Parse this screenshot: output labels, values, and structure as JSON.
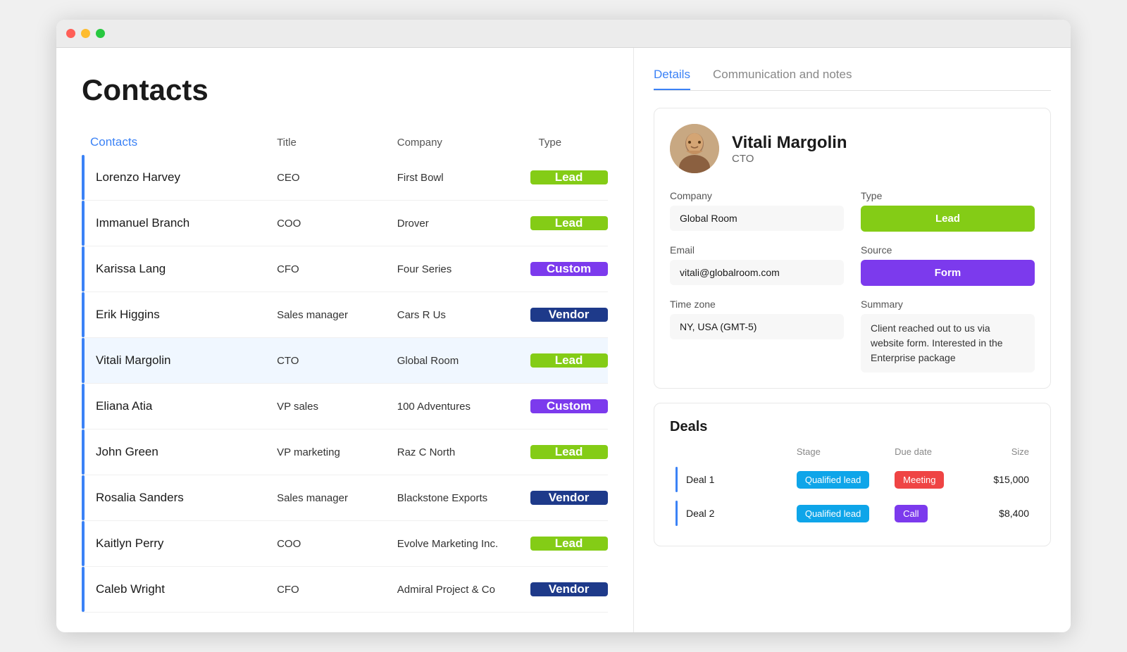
{
  "window": {
    "title": "Contacts"
  },
  "page": {
    "title": "Contacts"
  },
  "left_panel": {
    "columns": {
      "contacts": "Contacts",
      "title": "Title",
      "company": "Company",
      "type": "Type"
    },
    "rows": [
      {
        "name": "Lorenzo Harvey",
        "title": "CEO",
        "company": "First Bowl",
        "type": "Lead",
        "type_class": "type-lead",
        "selected": false
      },
      {
        "name": "Immanuel Branch",
        "title": "COO",
        "company": "Drover",
        "type": "Lead",
        "type_class": "type-lead",
        "selected": false
      },
      {
        "name": "Karissa Lang",
        "title": "CFO",
        "company": "Four Series",
        "type": "Custom",
        "type_class": "type-custom",
        "selected": false
      },
      {
        "name": "Erik Higgins",
        "title": "Sales manager",
        "company": "Cars R Us",
        "type": "Vendor",
        "type_class": "type-vendor",
        "selected": false
      },
      {
        "name": "Vitali Margolin",
        "title": "CTO",
        "company": "Global Room",
        "type": "Lead",
        "type_class": "type-lead",
        "selected": true
      },
      {
        "name": "Eliana Atia",
        "title": "VP sales",
        "company": "100 Adventures",
        "type": "Custom",
        "type_class": "type-custom",
        "selected": false
      },
      {
        "name": "John Green",
        "title": "VP marketing",
        "company": "Raz C North",
        "type": "Lead",
        "type_class": "type-lead",
        "selected": false
      },
      {
        "name": "Rosalia Sanders",
        "title": "Sales manager",
        "company": "Blackstone Exports",
        "type": "Vendor",
        "type_class": "type-vendor",
        "selected": false
      },
      {
        "name": "Kaitlyn Perry",
        "title": "COO",
        "company": "Evolve Marketing Inc.",
        "type": "Lead",
        "type_class": "type-lead",
        "selected": false
      },
      {
        "name": "Caleb Wright",
        "title": "CFO",
        "company": "Admiral Project & Co",
        "type": "Vendor",
        "type_class": "type-vendor",
        "selected": false
      }
    ]
  },
  "right_panel": {
    "tabs": [
      {
        "label": "Details",
        "active": true
      },
      {
        "label": "Communication and notes",
        "active": false
      }
    ],
    "contact": {
      "name": "Vitali Margolin",
      "role": "CTO",
      "company": "Global Room",
      "email": "vitali@globalroom.com",
      "timezone": "NY, USA (GMT-5)",
      "type": "Lead",
      "source": "Form",
      "summary": "Client reached out to us via website form. Interested in the Enterprise package"
    },
    "deals": {
      "title": "Deals",
      "columns": {
        "stage": "Stage",
        "due_date": "Due date",
        "size": "Size"
      },
      "rows": [
        {
          "name": "Deal 1",
          "stage": "Qualified lead",
          "stage_class": "stage-qualified",
          "due_date": "Meeting",
          "due_date_class": "stage-meeting",
          "size": "$15,000"
        },
        {
          "name": "Deal 2",
          "stage": "Qualified lead",
          "stage_class": "stage-qualified",
          "due_date": "Call",
          "due_date_class": "stage-call",
          "size": "$8,400"
        }
      ]
    }
  }
}
